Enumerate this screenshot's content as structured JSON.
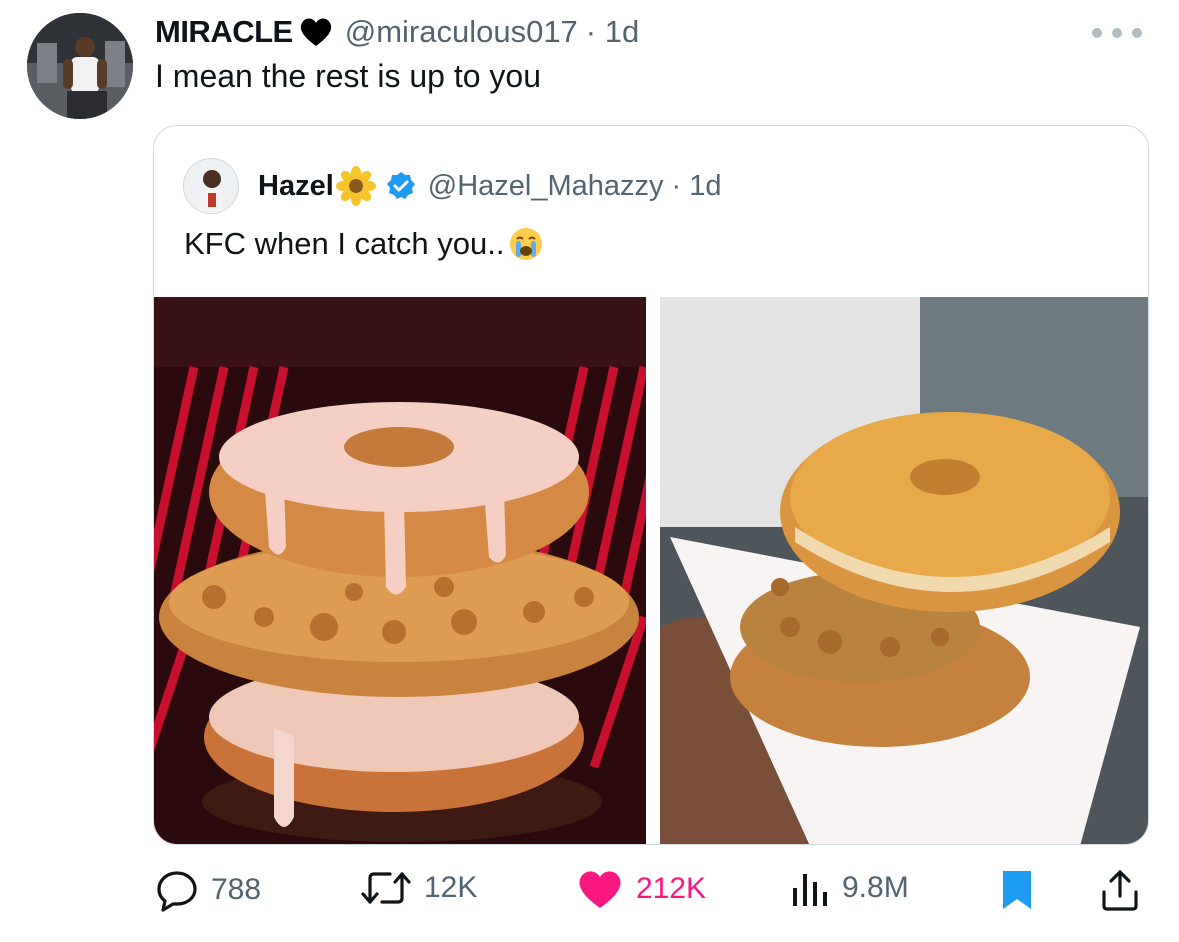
{
  "tweet": {
    "author_name": "MIRACLE",
    "author_handle": "@miraculous017",
    "time": "· 1d",
    "text": "I mean the rest is up to you"
  },
  "quoted": {
    "author_name": "Hazel",
    "author_handle": "@Hazel_Mahazzy",
    "time": "· 1d",
    "text": "KFC when I catch you.."
  },
  "metrics": {
    "replies": "788",
    "retweets": "12K",
    "likes": "212K",
    "views": "9.8M"
  },
  "colors": {
    "like": "#f91880",
    "verified": "#1d9bf0",
    "bookmark": "#1d9bf0",
    "muted": "#536471"
  },
  "icons": [
    "black-heart-icon",
    "more-icon",
    "flower-icon",
    "verified-icon",
    "crying-face-icon",
    "reply-icon",
    "retweet-icon",
    "like-icon",
    "views-icon",
    "bookmark-icon",
    "share-icon"
  ]
}
